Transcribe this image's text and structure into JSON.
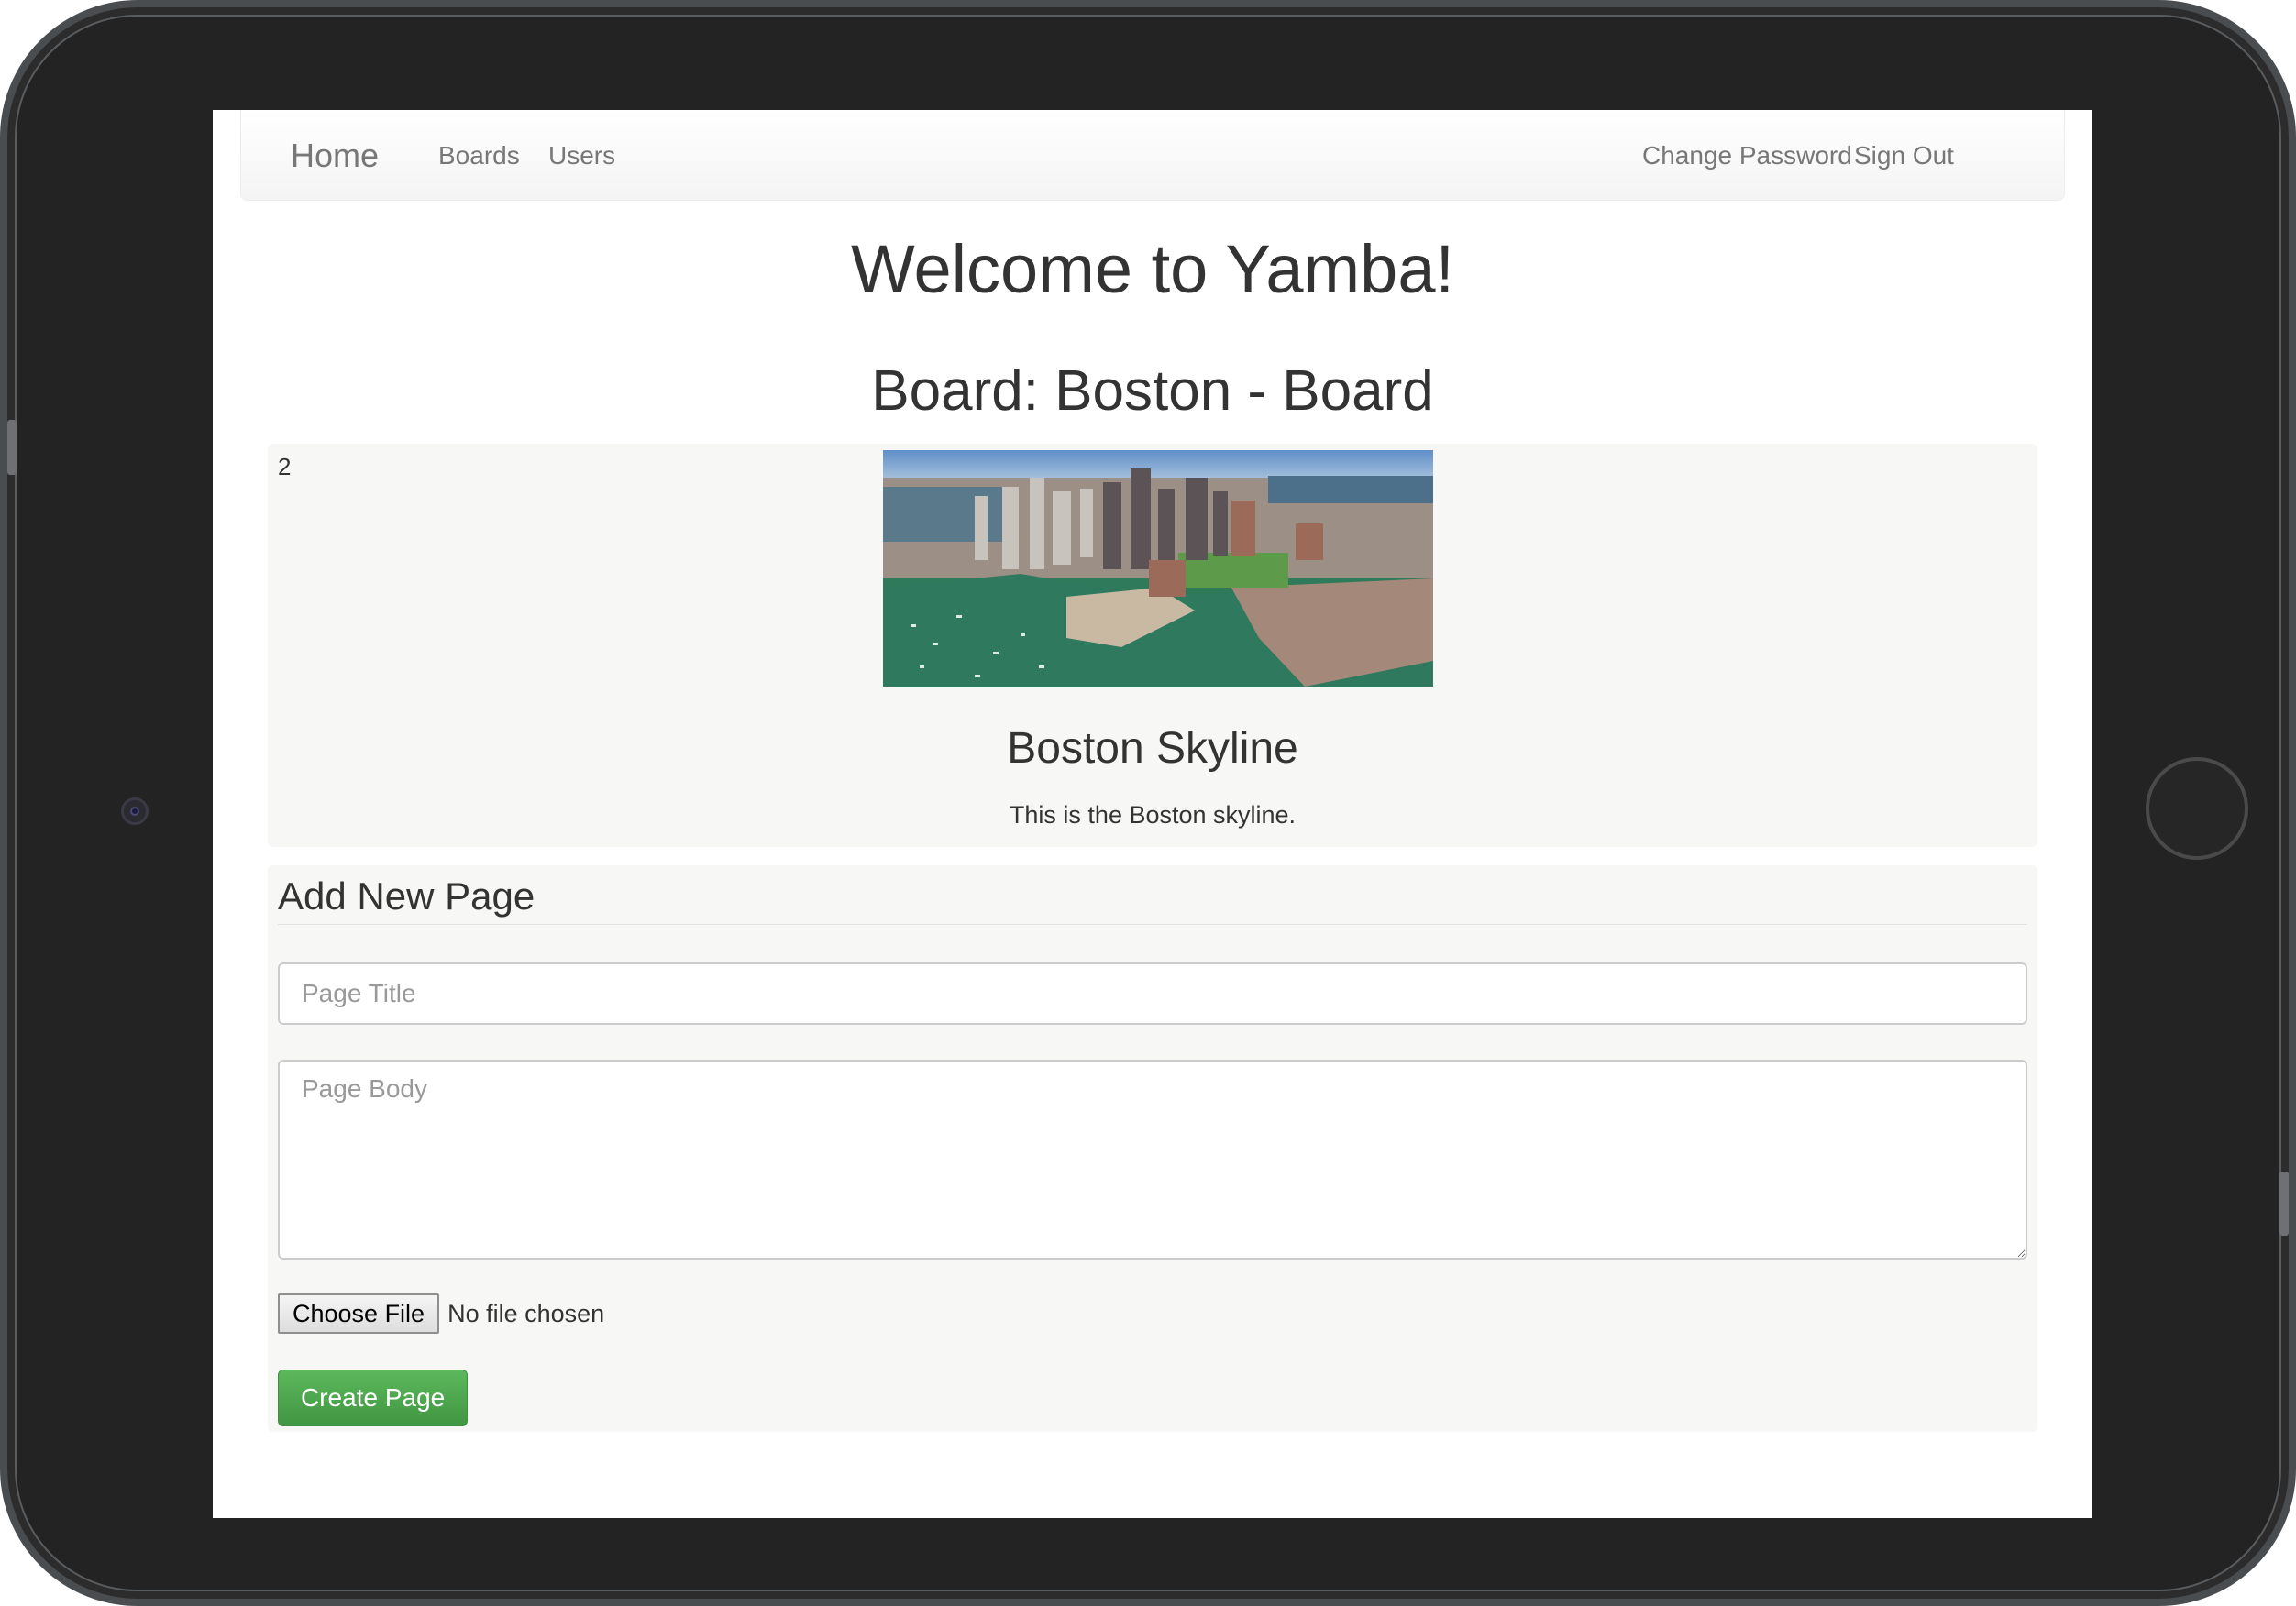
{
  "navbar": {
    "brand": "Home",
    "links": [
      "Boards",
      "Users"
    ],
    "right_links": [
      "Change Password",
      "Sign Out"
    ]
  },
  "page": {
    "heading": "Welcome to Yamba!",
    "board_heading": "Board: Boston - Board"
  },
  "board_page": {
    "number": "2",
    "image_icon": "boston-skyline-photo",
    "title": "Boston Skyline",
    "body": "This is the Boston skyline."
  },
  "form": {
    "legend": "Add New Page",
    "title_placeholder": "Page Title",
    "body_placeholder": "Page Body",
    "file_button": "Choose File",
    "file_status": "No file chosen",
    "submit_label": "Create Page"
  }
}
